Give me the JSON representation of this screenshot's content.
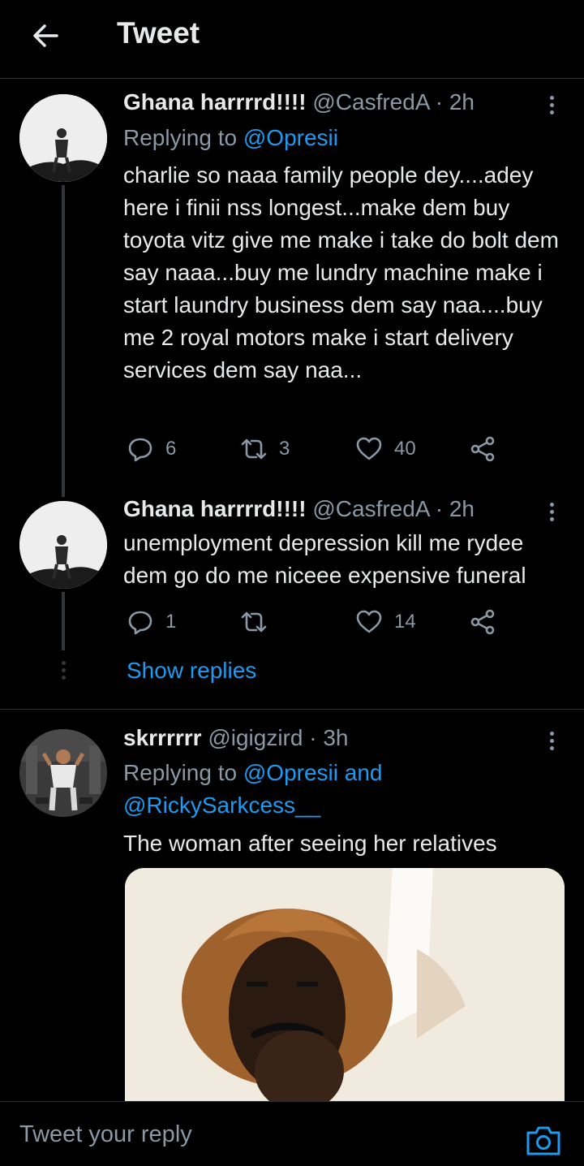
{
  "header": {
    "title": "Tweet"
  },
  "tweets": [
    {
      "name": "Ghana harrrrd!!!!",
      "handle": "@CasfredA",
      "dot": "·",
      "time": "2h",
      "replying_prefix": "Replying to",
      "replying_to": "@Opresii",
      "text": "charlie so naaa family people dey....adey here i finii nss longest...make dem buy toyota vitz give me make i take do bolt dem say naaa...buy me lundry machine make i start laundry business dem say naa....buy me 2 royal motors make i start delivery services dem say naa...",
      "replies": "6",
      "retweets": "3",
      "likes": "40"
    },
    {
      "name": "Ghana harrrrd!!!!",
      "handle": "@CasfredA",
      "dot": "·",
      "time": "2h",
      "text": "unemployment depression kill me rydee dem go do me niceee expensive funeral",
      "replies": "1",
      "retweets": "",
      "likes": "14"
    },
    {
      "name": "skrrrrrr",
      "handle": "@igigzird",
      "dot": "·",
      "time": "3h",
      "replying_prefix": "Replying to",
      "replying_to": "@Opresii and @RickySarkcess__",
      "text": "The woman after seeing her relatives"
    }
  ],
  "show_replies": "Show replies",
  "reply_bar": {
    "placeholder": "Tweet your reply"
  },
  "icons": {
    "back": "arrow-left-icon",
    "more": "more-vertical-icon",
    "reply": "reply-icon",
    "retweet": "retweet-icon",
    "like": "heart-icon",
    "share": "share-icon",
    "camera": "camera-icon"
  },
  "colors": {
    "accent": "#1d9bf0",
    "muted": "#8b98a5",
    "text": "#e7e9ea",
    "background": "#000000"
  }
}
